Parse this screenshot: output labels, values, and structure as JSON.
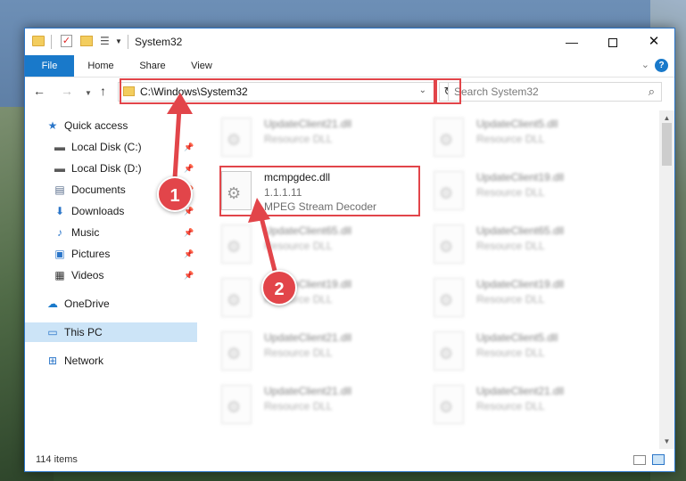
{
  "window": {
    "title": "System32",
    "minimize_glyph": "—",
    "close_glyph": "✕"
  },
  "ribbon": {
    "tabs": [
      "File",
      "Home",
      "Share",
      "View"
    ],
    "help": "?"
  },
  "nav": {
    "address": "C:\\Windows\\System32",
    "search_placeholder": "Search System32"
  },
  "sidebar": {
    "items": [
      {
        "label": "Quick access",
        "icon": "star-icon",
        "glyph": "★",
        "color": "#2b76c9",
        "pinned": false
      },
      {
        "label": "Local Disk (C:)",
        "icon": "drive-icon",
        "glyph": "▬",
        "color": "#5a5a5a",
        "pinned": true
      },
      {
        "label": "Local Disk (D:)",
        "icon": "drive-icon",
        "glyph": "▬",
        "color": "#5a5a5a",
        "pinned": true
      },
      {
        "label": "Documents",
        "icon": "documents-icon",
        "glyph": "▤",
        "color": "#5a6e8c",
        "pinned": true
      },
      {
        "label": "Downloads",
        "icon": "download-icon",
        "glyph": "⬇",
        "color": "#2b76c9",
        "pinned": true
      },
      {
        "label": "Music",
        "icon": "music-icon",
        "glyph": "♪",
        "color": "#2b76c9",
        "pinned": true
      },
      {
        "label": "Pictures",
        "icon": "pictures-icon",
        "glyph": "▣",
        "color": "#2b76c9",
        "pinned": true
      },
      {
        "label": "Videos",
        "icon": "video-icon",
        "glyph": "▦",
        "color": "#333333",
        "pinned": true
      },
      {
        "label": "OneDrive",
        "icon": "cloud-icon",
        "glyph": "☁",
        "color": "#1979ca",
        "pinned": false
      },
      {
        "label": "This PC",
        "icon": "computer-icon",
        "glyph": "▭",
        "color": "#2b76c9",
        "pinned": false
      },
      {
        "label": "Network",
        "icon": "network-icon",
        "glyph": "⊞",
        "color": "#2b76c9",
        "pinned": false
      }
    ]
  },
  "files": {
    "featured": {
      "name": "mcmpgdec.dll",
      "version": "1.1.1.11",
      "description": "MPEG Stream Decoder"
    },
    "left_column": [
      {
        "name": "UpdateClient21.dll",
        "desc": "Resource DLL"
      },
      {
        "name": "UpdateClient65.dll",
        "desc": "Resource DLL"
      },
      {
        "name": "UpdateClient19.dll",
        "desc": "Resource DLL"
      },
      {
        "name": "UpdateClient21.dll",
        "desc": "Resource DLL"
      },
      {
        "name": "UpdateClient21.dll",
        "desc": "Resource DLL"
      }
    ],
    "right_column": [
      {
        "name": "UpdateClient5.dll",
        "desc": "Resource DLL"
      },
      {
        "name": "UpdateClient19.dll",
        "desc": "Resource DLL"
      },
      {
        "name": "UpdateClient65.dll",
        "desc": "Resource DLL"
      },
      {
        "name": "UpdateClient19.dll",
        "desc": "Resource DLL"
      },
      {
        "name": "UpdateClient5.dll",
        "desc": "Resource DLL"
      },
      {
        "name": "UpdateClient21.dll",
        "desc": "Resource DLL"
      }
    ]
  },
  "status": {
    "item_count": "114 items"
  },
  "annotations": {
    "step1": "1",
    "step2": "2",
    "color": "#e2454a"
  }
}
